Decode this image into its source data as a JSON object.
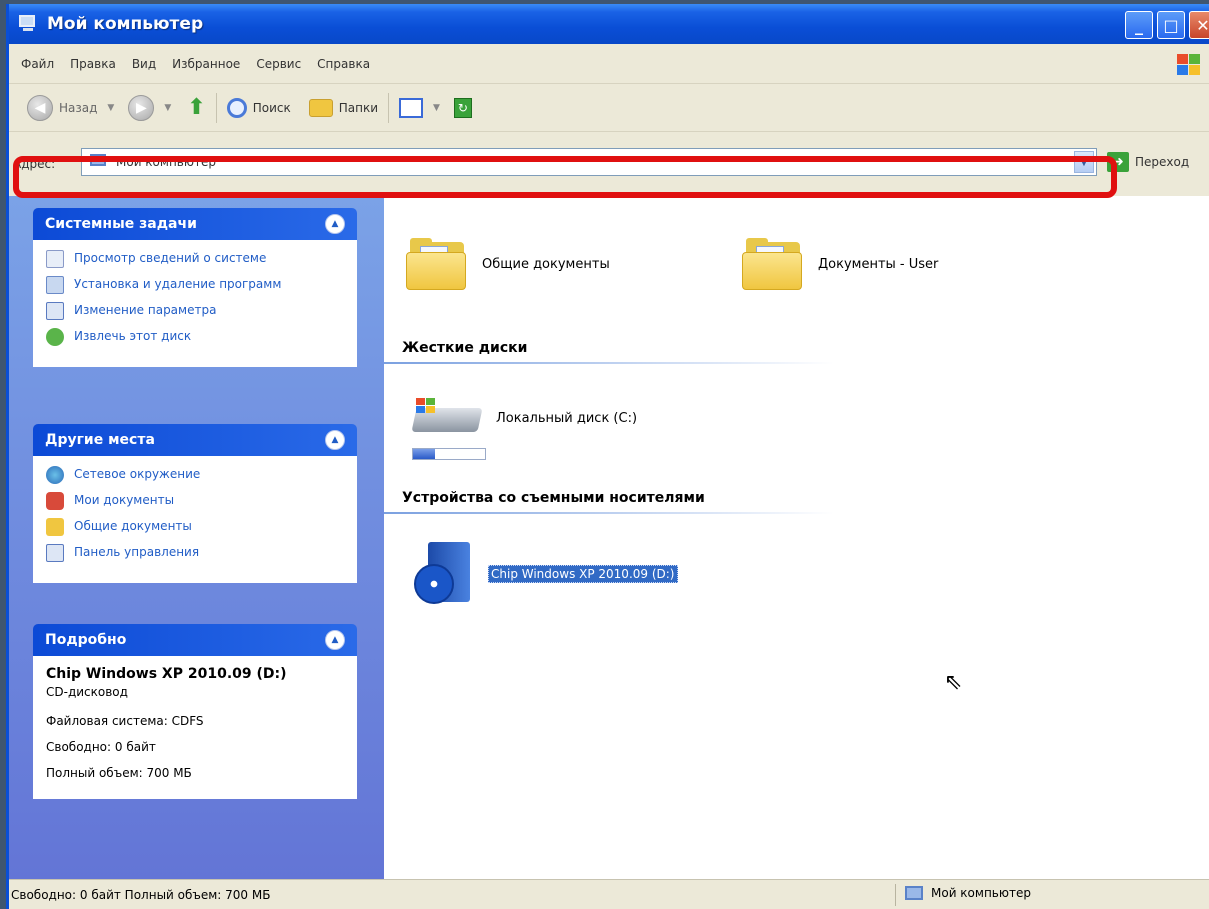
{
  "window": {
    "title": "Мой компьютер"
  },
  "menu": [
    "Файл",
    "Правка",
    "Вид",
    "Избранное",
    "Сервис",
    "Справка"
  ],
  "toolbar": {
    "back_label": "Назад",
    "search_label": "Поиск",
    "folders_label": "Папки"
  },
  "address": {
    "label": "Адрес:",
    "value": "Мой компьютер",
    "go_label": "Переход"
  },
  "panels": {
    "system": {
      "title": "Системные задачи",
      "items": [
        "Просмотр сведений о системе",
        "Установка и удаление программ",
        "Изменение параметра",
        "Извлечь этот диск"
      ]
    },
    "places": {
      "title": "Другие места",
      "items": [
        "Сетевое окружение",
        "Мои документы",
        "Общие документы",
        "Панель управления"
      ]
    },
    "details": {
      "title": "Подробно",
      "name": "Chip Windows XP 2010.09 (D:)",
      "type": "CD-дисковод",
      "fs": "Файловая система: CDFS",
      "free": "Свободно: 0 байт",
      "total": "Полный объем: 700 МБ"
    }
  },
  "content": {
    "folders": [
      "Общие документы",
      "Документы - User"
    ],
    "hdd_group": "Жесткие диски",
    "hdd": {
      "label": "Локальный диск (C:)",
      "used_fraction": 0.3
    },
    "removable_group": "Устройства со съемными носителями",
    "removable": "Chip Windows XP 2010.09 (D:)"
  },
  "status": {
    "left": "Свободно: 0 байт Полный объем: 700 МБ",
    "right": "Мой компьютер"
  },
  "colors": {
    "titlebar": "#0a4ed6",
    "taskpane": "#6375d6",
    "highlight": "#e01010",
    "selection": "#316ac5"
  }
}
